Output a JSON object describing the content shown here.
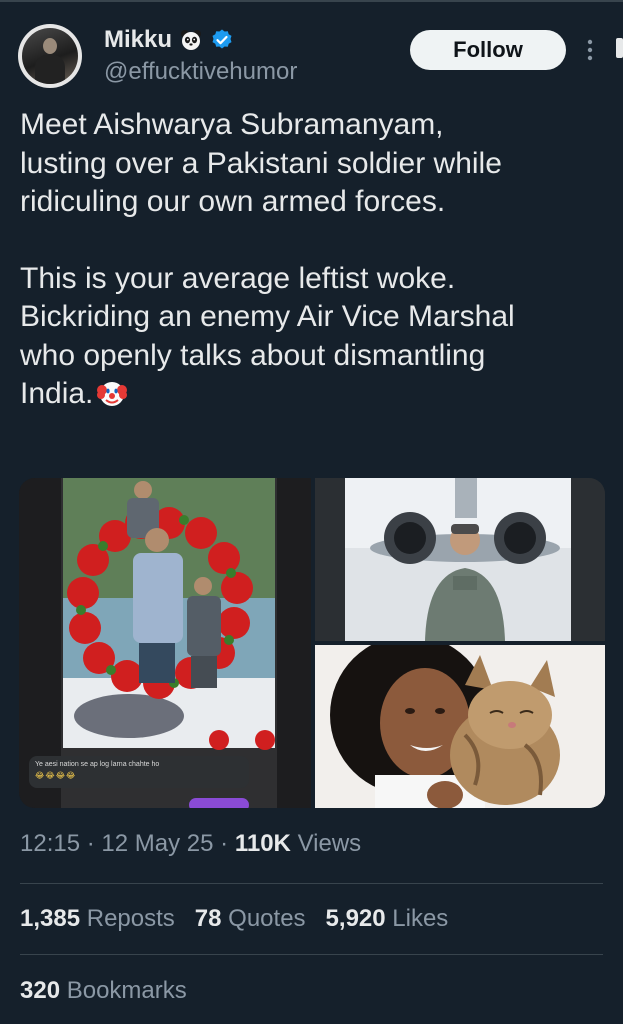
{
  "author": {
    "display_name": "Mikku",
    "handle": "@effucktivehumor",
    "badge_emoji": "panda-icon",
    "verified_icon": "verified-badge-icon"
  },
  "follow_label": "Follow",
  "tweet": {
    "paragraph1": "Meet Aishwarya Subramanyam,\nlusting over a Pakistani soldier while\nridiculing our own armed forces.",
    "paragraph2": "This is your average leftist woke.\nBickriding an enemy Air Vice Marshal\nwho openly talks about dismantling\nIndia.",
    "trailing_emoji": "clown-face-icon"
  },
  "media": {
    "caption_text": "Ye aesi nation se ap log larna chahte ho",
    "caption_emojis": "😂😂😂😂"
  },
  "meta": {
    "time": "12:15",
    "separator": "·",
    "date": "12 May 25",
    "views_count": "110K",
    "views_label": "Views"
  },
  "stats": {
    "reposts_count": "1,385",
    "reposts_label": "Reposts",
    "quotes_count": "78",
    "quotes_label": "Quotes",
    "likes_count": "5,920",
    "likes_label": "Likes",
    "bookmarks_count": "320",
    "bookmarks_label": "Bookmarks"
  },
  "colors": {
    "background": "#15202b",
    "text_primary": "#e7e9ea",
    "text_secondary": "#8b98a5",
    "verified_blue": "#1d9bf0",
    "divider": "#38444d"
  }
}
